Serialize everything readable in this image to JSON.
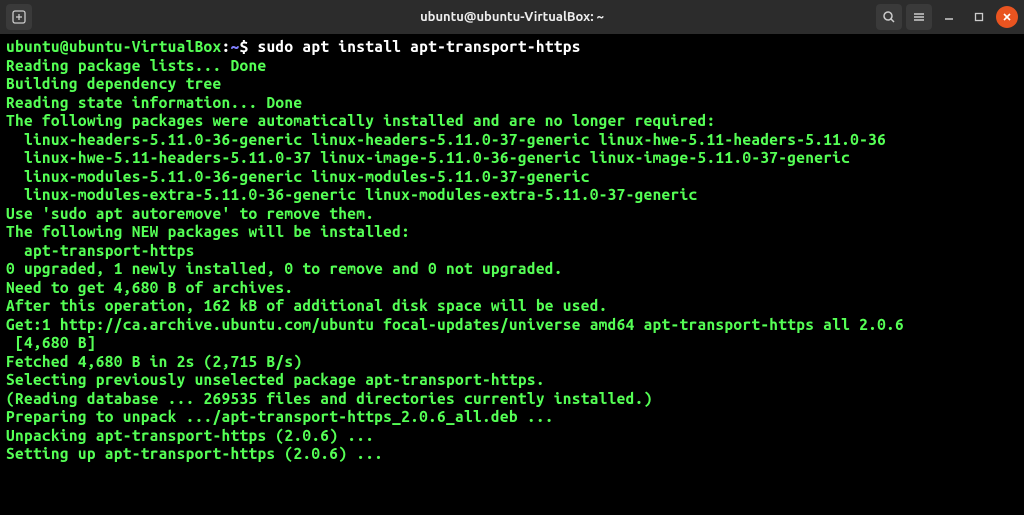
{
  "window": {
    "title": "ubuntu@ubuntu-VirtualBox: ~",
    "icons": {
      "newtab": "⊞",
      "search": "search-icon",
      "menu": "menu-icon",
      "minimize": "—",
      "maximize": "▢",
      "close": "✕"
    }
  },
  "prompt": {
    "userhost": "ubuntu@ubuntu-VirtualBox",
    "colon": ":",
    "path": "~",
    "dollar": "$"
  },
  "command": "sudo apt install apt-transport-https",
  "output": [
    "Reading package lists... Done",
    "Building dependency tree",
    "Reading state information... Done",
    "The following packages were automatically installed and are no longer required:",
    "  linux-headers-5.11.0-36-generic linux-headers-5.11.0-37-generic linux-hwe-5.11-headers-5.11.0-36",
    "  linux-hwe-5.11-headers-5.11.0-37 linux-image-5.11.0-36-generic linux-image-5.11.0-37-generic",
    "  linux-modules-5.11.0-36-generic linux-modules-5.11.0-37-generic",
    "  linux-modules-extra-5.11.0-36-generic linux-modules-extra-5.11.0-37-generic",
    "Use 'sudo apt autoremove' to remove them.",
    "The following NEW packages will be installed:",
    "  apt-transport-https",
    "0 upgraded, 1 newly installed, 0 to remove and 0 not upgraded.",
    "Need to get 4,680 B of archives.",
    "After this operation, 162 kB of additional disk space will be used.",
    "Get:1 http://ca.archive.ubuntu.com/ubuntu focal-updates/universe amd64 apt-transport-https all 2.0.6",
    " [4,680 B]",
    "Fetched 4,680 B in 2s (2,715 B/s)",
    "Selecting previously unselected package apt-transport-https.",
    "(Reading database ... 269535 files and directories currently installed.)",
    "Preparing to unpack .../apt-transport-https_2.0.6_all.deb ...",
    "Unpacking apt-transport-https (2.0.6) ...",
    "Setting up apt-transport-https (2.0.6) ..."
  ]
}
